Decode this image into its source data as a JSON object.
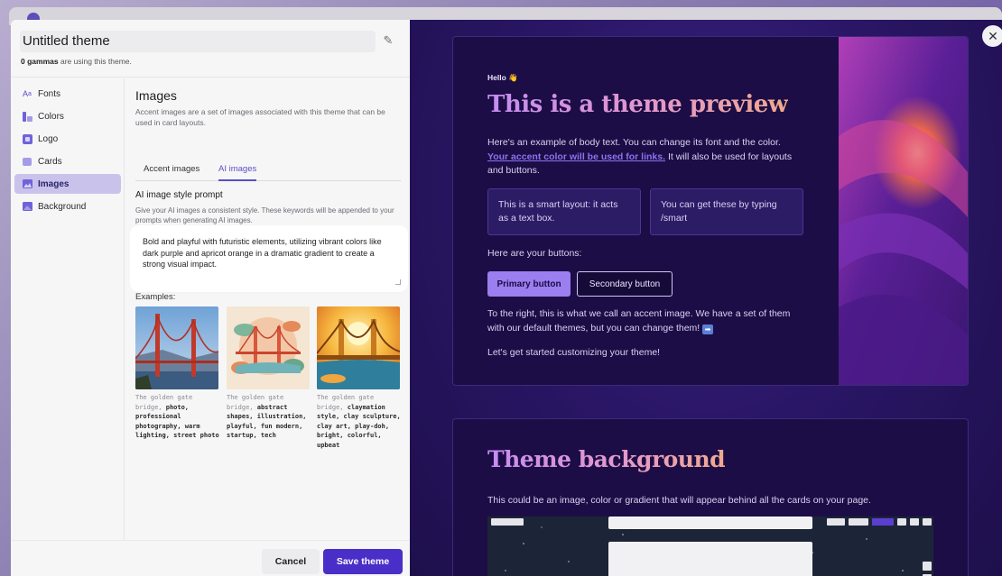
{
  "editor": {
    "title": "Untitled theme",
    "usage_count": "0 gammas",
    "usage_suffix": "are using this theme.",
    "nav": [
      {
        "label": "Fonts",
        "icon": "font-icon"
      },
      {
        "label": "Colors",
        "icon": "palette-icon"
      },
      {
        "label": "Logo",
        "icon": "logo-icon"
      },
      {
        "label": "Cards",
        "icon": "card-icon"
      },
      {
        "label": "Images",
        "icon": "images-icon",
        "active": true
      },
      {
        "label": "Background",
        "icon": "background-icon"
      }
    ],
    "section_title": "Images",
    "section_desc": "Accent images are a set of images associated with this theme that can be used in card layouts.",
    "tabs": [
      "Accent images",
      "AI images"
    ],
    "active_tab": "AI images",
    "prompt_label": "AI image style prompt",
    "prompt_help": "Give your AI images a consistent style. These keywords will be appended to your prompts when generating AI images.",
    "prompt_value": "Bold and playful with futuristic elements, utilizing vibrant colors like dark purple and apricot orange in a dramatic gradient to create a strong visual impact.",
    "examples_label": "Examples:",
    "examples": [
      {
        "prefix": "The golden gate bridge,",
        "keywords": "photo, professional photography, warm lighting, street photo"
      },
      {
        "prefix": "The golden gate bridge,",
        "keywords": "abstract shapes, illustration, playful, fun modern, startup, tech"
      },
      {
        "prefix": "The golden gate bridge,",
        "keywords": "claymation style, clay sculpture, clay art, play-doh, bright, colorful, upbeat"
      }
    ],
    "cancel_label": "Cancel",
    "save_label": "Save theme"
  },
  "preview": {
    "hello": "Hello 👋",
    "title": "This is a theme preview",
    "body_text_1": "Here's an example of body text. You can change its font and the color.",
    "accent_link": "Your accent color will be used for links.",
    "body_text_2": "It will also be used for layouts and buttons.",
    "smart_box_1": "This is a smart layout: it acts as a text box.",
    "smart_box_2": "You can get these by typing /smart",
    "buttons_label": "Here are your buttons:",
    "primary_button": "Primary button",
    "secondary_button": "Secondary button",
    "accent_note": "To the right, this is what we call an accent image. We have a set of them with our default themes, but you can change them!",
    "get_started": "Let's get started customizing your theme!",
    "bg_title": "Theme background",
    "bg_desc": "This could be an image, color or gradient that will appear behind all the cards on your page."
  },
  "colors": {
    "accent": "#5b4fc4",
    "save_button": "#4a2ec8",
    "preview_bg": "#2a1666",
    "primary_button": "#9b7ef0"
  }
}
